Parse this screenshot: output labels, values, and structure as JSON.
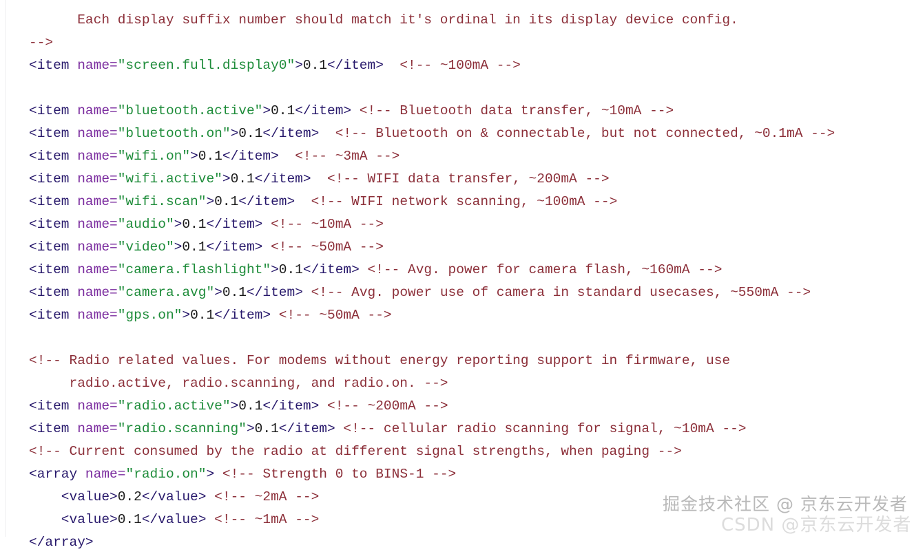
{
  "document": {
    "kind": "xml-source-code",
    "language": "XML",
    "theme": "light",
    "colors": {
      "background": "#ffffff",
      "tag": "#27186b",
      "attribute": "#7a2b9e",
      "attribute_value": "#1e8c3a",
      "text_node": "#1a1a1a",
      "comment": "#8c2f39",
      "left_rule": "#ededf0",
      "watermark_primary": "#b9b9b9",
      "watermark_secondary": "#dcdcdc"
    }
  },
  "code": {
    "lines": [
      {
        "indent": 0,
        "clipped_top": true,
        "tokens": [
          {
            "t": "cmt",
            "v": "      Each display suffix number should match it's ordinal in its display device config."
          }
        ]
      },
      {
        "indent": 0,
        "tokens": [
          {
            "t": "cmt",
            "v": "-->"
          }
        ]
      },
      {
        "indent": 0,
        "tokens": [
          {
            "t": "tag",
            "v": "<item "
          },
          {
            "t": "attr",
            "v": "name="
          },
          {
            "t": "str",
            "v": "\"screen.full.display0\""
          },
          {
            "t": "tag",
            "v": ">"
          },
          {
            "t": "text",
            "v": "0.1"
          },
          {
            "t": "tag",
            "v": "</item>"
          },
          {
            "t": "cmt",
            "v": "  <!-- ~100mA -->"
          }
        ]
      },
      {
        "indent": 0,
        "blank": true,
        "tokens": []
      },
      {
        "indent": 0,
        "tokens": [
          {
            "t": "tag",
            "v": "<item "
          },
          {
            "t": "attr",
            "v": "name="
          },
          {
            "t": "str",
            "v": "\"bluetooth.active\""
          },
          {
            "t": "tag",
            "v": ">"
          },
          {
            "t": "text",
            "v": "0.1"
          },
          {
            "t": "tag",
            "v": "</item>"
          },
          {
            "t": "cmt",
            "v": " <!-- Bluetooth data transfer, ~10mA -->"
          }
        ]
      },
      {
        "indent": 0,
        "tokens": [
          {
            "t": "tag",
            "v": "<item "
          },
          {
            "t": "attr",
            "v": "name="
          },
          {
            "t": "str",
            "v": "\"bluetooth.on\""
          },
          {
            "t": "tag",
            "v": ">"
          },
          {
            "t": "text",
            "v": "0.1"
          },
          {
            "t": "tag",
            "v": "</item>"
          },
          {
            "t": "cmt",
            "v": "  <!-- Bluetooth on & connectable, but not connected, ~0.1mA -->"
          }
        ]
      },
      {
        "indent": 0,
        "tokens": [
          {
            "t": "tag",
            "v": "<item "
          },
          {
            "t": "attr",
            "v": "name="
          },
          {
            "t": "str",
            "v": "\"wifi.on\""
          },
          {
            "t": "tag",
            "v": ">"
          },
          {
            "t": "text",
            "v": "0.1"
          },
          {
            "t": "tag",
            "v": "</item>"
          },
          {
            "t": "cmt",
            "v": "  <!-- ~3mA -->"
          }
        ]
      },
      {
        "indent": 0,
        "tokens": [
          {
            "t": "tag",
            "v": "<item "
          },
          {
            "t": "attr",
            "v": "name="
          },
          {
            "t": "str",
            "v": "\"wifi.active\""
          },
          {
            "t": "tag",
            "v": ">"
          },
          {
            "t": "text",
            "v": "0.1"
          },
          {
            "t": "tag",
            "v": "</item>"
          },
          {
            "t": "cmt",
            "v": "  <!-- WIFI data transfer, ~200mA -->"
          }
        ]
      },
      {
        "indent": 0,
        "tokens": [
          {
            "t": "tag",
            "v": "<item "
          },
          {
            "t": "attr",
            "v": "name="
          },
          {
            "t": "str",
            "v": "\"wifi.scan\""
          },
          {
            "t": "tag",
            "v": ">"
          },
          {
            "t": "text",
            "v": "0.1"
          },
          {
            "t": "tag",
            "v": "</item>"
          },
          {
            "t": "cmt",
            "v": "  <!-- WIFI network scanning, ~100mA -->"
          }
        ]
      },
      {
        "indent": 0,
        "tokens": [
          {
            "t": "tag",
            "v": "<item "
          },
          {
            "t": "attr",
            "v": "name="
          },
          {
            "t": "str",
            "v": "\"audio\""
          },
          {
            "t": "tag",
            "v": ">"
          },
          {
            "t": "text",
            "v": "0.1"
          },
          {
            "t": "tag",
            "v": "</item>"
          },
          {
            "t": "cmt",
            "v": " <!-- ~10mA -->"
          }
        ]
      },
      {
        "indent": 0,
        "tokens": [
          {
            "t": "tag",
            "v": "<item "
          },
          {
            "t": "attr",
            "v": "name="
          },
          {
            "t": "str",
            "v": "\"video\""
          },
          {
            "t": "tag",
            "v": ">"
          },
          {
            "t": "text",
            "v": "0.1"
          },
          {
            "t": "tag",
            "v": "</item>"
          },
          {
            "t": "cmt",
            "v": " <!-- ~50mA -->"
          }
        ]
      },
      {
        "indent": 0,
        "tokens": [
          {
            "t": "tag",
            "v": "<item "
          },
          {
            "t": "attr",
            "v": "name="
          },
          {
            "t": "str",
            "v": "\"camera.flashlight\""
          },
          {
            "t": "tag",
            "v": ">"
          },
          {
            "t": "text",
            "v": "0.1"
          },
          {
            "t": "tag",
            "v": "</item>"
          },
          {
            "t": "cmt",
            "v": " <!-- Avg. power for camera flash, ~160mA -->"
          }
        ]
      },
      {
        "indent": 0,
        "tokens": [
          {
            "t": "tag",
            "v": "<item "
          },
          {
            "t": "attr",
            "v": "name="
          },
          {
            "t": "str",
            "v": "\"camera.avg\""
          },
          {
            "t": "tag",
            "v": ">"
          },
          {
            "t": "text",
            "v": "0.1"
          },
          {
            "t": "tag",
            "v": "</item>"
          },
          {
            "t": "cmt",
            "v": " <!-- Avg. power use of camera in standard usecases, ~550mA -->"
          }
        ]
      },
      {
        "indent": 0,
        "tokens": [
          {
            "t": "tag",
            "v": "<item "
          },
          {
            "t": "attr",
            "v": "name="
          },
          {
            "t": "str",
            "v": "\"gps.on\""
          },
          {
            "t": "tag",
            "v": ">"
          },
          {
            "t": "text",
            "v": "0.1"
          },
          {
            "t": "tag",
            "v": "</item>"
          },
          {
            "t": "cmt",
            "v": " <!-- ~50mA -->"
          }
        ]
      },
      {
        "indent": 0,
        "blank": true,
        "tokens": []
      },
      {
        "indent": 0,
        "tokens": [
          {
            "t": "cmt",
            "v": "<!-- Radio related values. For modems without energy reporting support in firmware, use"
          }
        ]
      },
      {
        "indent": 0,
        "tokens": [
          {
            "t": "cmt",
            "v": "     radio.active, radio.scanning, and radio.on. -->"
          }
        ]
      },
      {
        "indent": 0,
        "tokens": [
          {
            "t": "tag",
            "v": "<item "
          },
          {
            "t": "attr",
            "v": "name="
          },
          {
            "t": "str",
            "v": "\"radio.active\""
          },
          {
            "t": "tag",
            "v": ">"
          },
          {
            "t": "text",
            "v": "0.1"
          },
          {
            "t": "tag",
            "v": "</item>"
          },
          {
            "t": "cmt",
            "v": " <!-- ~200mA -->"
          }
        ]
      },
      {
        "indent": 0,
        "tokens": [
          {
            "t": "tag",
            "v": "<item "
          },
          {
            "t": "attr",
            "v": "name="
          },
          {
            "t": "str",
            "v": "\"radio.scanning\""
          },
          {
            "t": "tag",
            "v": ">"
          },
          {
            "t": "text",
            "v": "0.1"
          },
          {
            "t": "tag",
            "v": "</item>"
          },
          {
            "t": "cmt",
            "v": " <!-- cellular radio scanning for signal, ~10mA -->"
          }
        ]
      },
      {
        "indent": 0,
        "tokens": [
          {
            "t": "cmt",
            "v": "<!-- Current consumed by the radio at different signal strengths, when paging -->"
          }
        ]
      },
      {
        "indent": 0,
        "tokens": [
          {
            "t": "tag",
            "v": "<array "
          },
          {
            "t": "attr",
            "v": "name="
          },
          {
            "t": "str",
            "v": "\"radio.on\""
          },
          {
            "t": "tag",
            "v": ">"
          },
          {
            "t": "cmt",
            "v": " <!-- Strength 0 to BINS-1 -->"
          }
        ]
      },
      {
        "indent": 0,
        "tokens": [
          {
            "t": "tag",
            "v": "    <value>"
          },
          {
            "t": "text",
            "v": "0.2"
          },
          {
            "t": "tag",
            "v": "</value>"
          },
          {
            "t": "cmt",
            "v": " <!-- ~2mA -->"
          }
        ]
      },
      {
        "indent": 0,
        "tokens": [
          {
            "t": "tag",
            "v": "    <value>"
          },
          {
            "t": "text",
            "v": "0.1"
          },
          {
            "t": "tag",
            "v": "</value>"
          },
          {
            "t": "cmt",
            "v": " <!-- ~1mA -->"
          }
        ]
      },
      {
        "indent": 0,
        "tokens": [
          {
            "t": "tag",
            "v": "</array>"
          }
        ]
      }
    ]
  },
  "watermarks": {
    "juejin": "掘金技术社区 @ 京东云开发者",
    "csdn": "CSDN @京东云开发者"
  }
}
